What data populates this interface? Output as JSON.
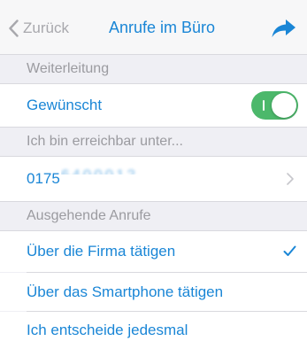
{
  "nav": {
    "back_label": "Zurück",
    "title": "Anrufe im Büro",
    "share_icon": "share-arrow-icon"
  },
  "forwarding": {
    "header": "Weiterleitung",
    "wanted_label": "Gewünscht",
    "wanted_on": true
  },
  "reachable": {
    "header": "Ich bin erreichbar unter...",
    "phone_visible": "0175",
    "phone_obscured": "6400012"
  },
  "outgoing": {
    "header": "Ausgehende Anrufe",
    "options": [
      {
        "label": "Über die Firma tätigen",
        "selected": true
      },
      {
        "label": "Über das Smartphone tätigen",
        "selected": false
      },
      {
        "label": "Ich entscheide jedesmal",
        "selected": false
      }
    ]
  },
  "colors": {
    "accent": "#1a86d6",
    "toggle_on": "#4cb86b",
    "secondary_text": "#9b9ba0",
    "background": "#efeff4"
  }
}
